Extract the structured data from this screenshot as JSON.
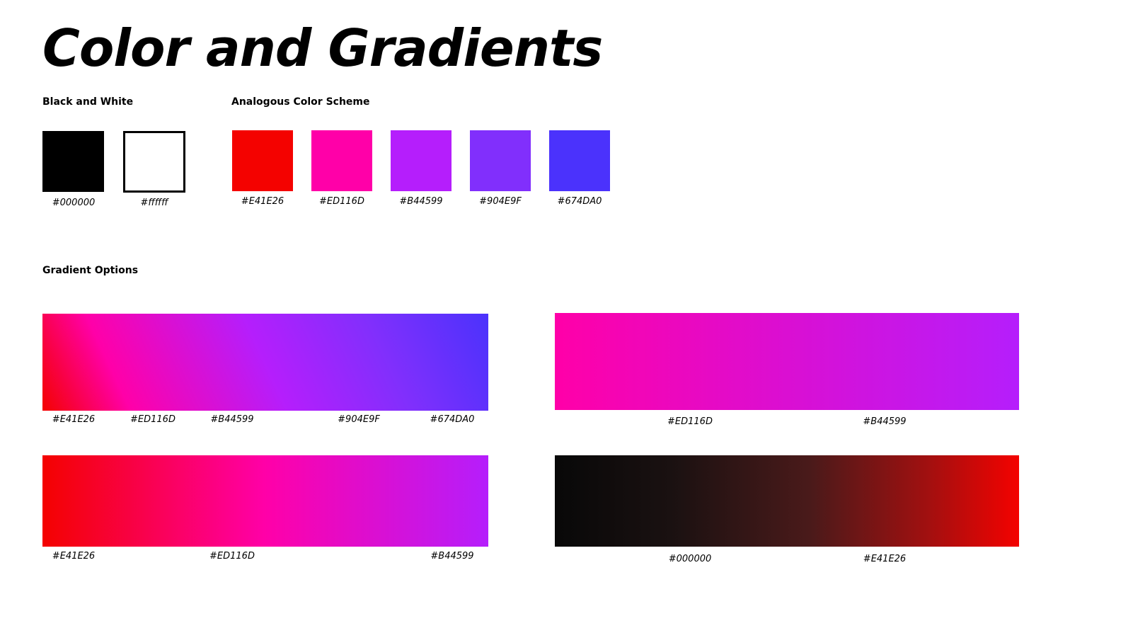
{
  "title": "Color and Gradients",
  "black_white": {
    "label": "Black and White",
    "swatches": [
      {
        "hex": "#000000",
        "color": "#000000"
      },
      {
        "hex": "#ffffff",
        "color": "#ffffff"
      }
    ]
  },
  "analogous": {
    "label": "Analogous Color Scheme",
    "swatches": [
      {
        "hex": "#E41E26",
        "color": "#f40200"
      },
      {
        "hex": "#ED116D",
        "color": "#ff00a8"
      },
      {
        "hex": "#B44599",
        "color": "#b51efc"
      },
      {
        "hex": "#904E9F",
        "color": "#812ffc"
      },
      {
        "hex": "#674DA0",
        "color": "#4b32fc"
      }
    ]
  },
  "gradients": {
    "label": "Gradient Options",
    "items": [
      {
        "stops": [
          "#E41E26",
          "#ED116D",
          "#B44599",
          "#904E9F",
          "#674DA0"
        ]
      },
      {
        "stops": [
          "#ED116D",
          "#B44599"
        ]
      },
      {
        "stops": [
          "#E41E26",
          "#ED116D",
          "#B44599"
        ]
      },
      {
        "stops": [
          "#000000",
          "#E41E26"
        ]
      }
    ]
  }
}
